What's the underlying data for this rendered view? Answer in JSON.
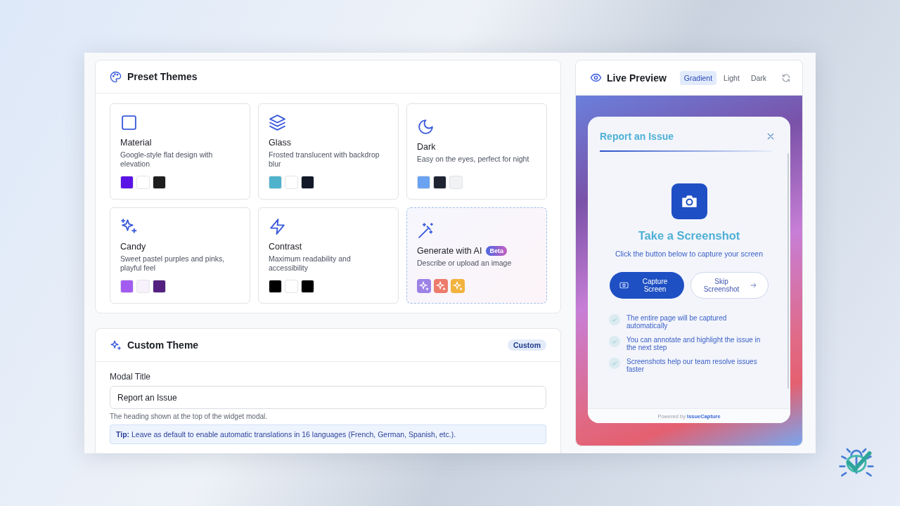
{
  "preset_themes": {
    "title": "Preset Themes",
    "themes": [
      {
        "kind": "preset",
        "name": "Material",
        "description": "Google-style flat design with elevation",
        "swatches": [
          {
            "color": "#5b12e6"
          },
          {
            "color": "#ffffff"
          },
          {
            "color": "#1e1e1e"
          }
        ]
      },
      {
        "kind": "preset",
        "name": "Glass",
        "description": "Frosted translucent with backdrop blur",
        "swatches": [
          {
            "color": "#4fb3cc"
          },
          {
            "color": "#ffffff"
          },
          {
            "color": "#111827"
          }
        ]
      },
      {
        "kind": "preset",
        "name": "Dark",
        "description": "Easy on the eyes, perfect for night",
        "swatches": [
          {
            "color": "#6aa2f2"
          },
          {
            "color": "#1f2433"
          },
          {
            "color": "#f1f2f4"
          }
        ]
      },
      {
        "kind": "preset",
        "name": "Candy",
        "description": "Sweet pastel purples and pinks, playful feel",
        "swatches": [
          {
            "color": "#a35cf0"
          },
          {
            "color": "#f6f1fb"
          },
          {
            "color": "#53207f"
          }
        ]
      },
      {
        "kind": "preset",
        "name": "Contrast",
        "description": "Maximum readability and accessibility",
        "swatches": [
          {
            "color": "#000000"
          },
          {
            "color": "#ffffff"
          },
          {
            "color": "#000000"
          }
        ]
      },
      {
        "kind": "generate",
        "name": "Generate with AI",
        "badge": "Beta",
        "description": "Describe or upload an image",
        "swatches": [
          {
            "color": "#9d82e6"
          },
          {
            "color": "#ec7b6c"
          },
          {
            "color": "#f2b23e"
          }
        ]
      }
    ]
  },
  "custom_theme": {
    "title": "Custom Theme",
    "badge": "Custom",
    "field": {
      "label": "Modal Title",
      "value": "Report an Issue",
      "help": "The heading shown at the top of the widget modal."
    },
    "tip": "**Tip:** Leave as default to enable automatic translations in 16 languages (French, German, Spanish, etc.)."
  },
  "live_preview": {
    "title": "Live Preview",
    "tabs": [
      {
        "label": "Gradient",
        "selected": true
      },
      {
        "label": "Light",
        "selected": false
      },
      {
        "label": "Dark",
        "selected": false
      }
    ],
    "modal": {
      "title": "Report an Issue",
      "heading": "Take a Screenshot",
      "subtitle": "Click the button below to capture your screen",
      "buttons": [
        {
          "kind": "primary",
          "label": "Capture Screen"
        },
        {
          "kind": "secondary",
          "label": "Skip Screenshot"
        }
      ],
      "checklist": [
        "The entire page will be captured automatically",
        "You can annotate and highlight the issue in the next step",
        "Screenshots help our team resolve issues faster"
      ],
      "footer": "Powered by **IssueCapture**"
    }
  }
}
